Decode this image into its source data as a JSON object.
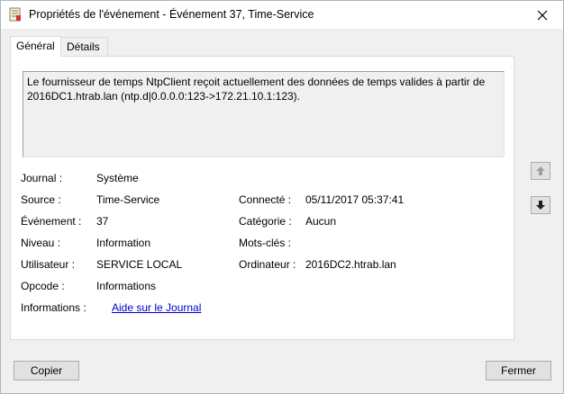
{
  "window": {
    "title": "Propriétés de l'événement - Événement 37, Time-Service"
  },
  "tabs": [
    {
      "label": "Général"
    },
    {
      "label": "Détails"
    }
  ],
  "description": "Le fournisseur de temps NtpClient reçoit actuellement des données de temps valides à partir de 2016DC1.htrab.lan (ntp.d|0.0.0.0:123->172.21.10.1:123).",
  "fields": {
    "journal": {
      "label": "Journal :",
      "value": "Système"
    },
    "source": {
      "label": "Source :",
      "value": "Time-Service"
    },
    "evenement": {
      "label": "Événement :",
      "value": "37"
    },
    "niveau": {
      "label": "Niveau :",
      "value": "Information"
    },
    "utilisateur": {
      "label": "Utilisateur :",
      "value": "SERVICE LOCAL"
    },
    "opcode": {
      "label": "Opcode :",
      "value": "Informations"
    },
    "informations": {
      "label": "Informations :",
      "value": "Aide sur le Journal"
    },
    "connecte": {
      "label": "Connecté :",
      "value": "05/11/2017 05:37:41"
    },
    "categorie": {
      "label": "Catégorie :",
      "value": "Aucun"
    },
    "mots_cles": {
      "label": "Mots-clés :",
      "value": ""
    },
    "ordinateur": {
      "label": "Ordinateur :",
      "value": "2016DC2.htrab.lan"
    }
  },
  "buttons": {
    "copy": "Copier",
    "close": "Fermer"
  },
  "icons": {
    "app": "event-properties-icon",
    "close": "close-icon",
    "up": "arrow-up-icon",
    "down": "arrow-down-icon"
  }
}
